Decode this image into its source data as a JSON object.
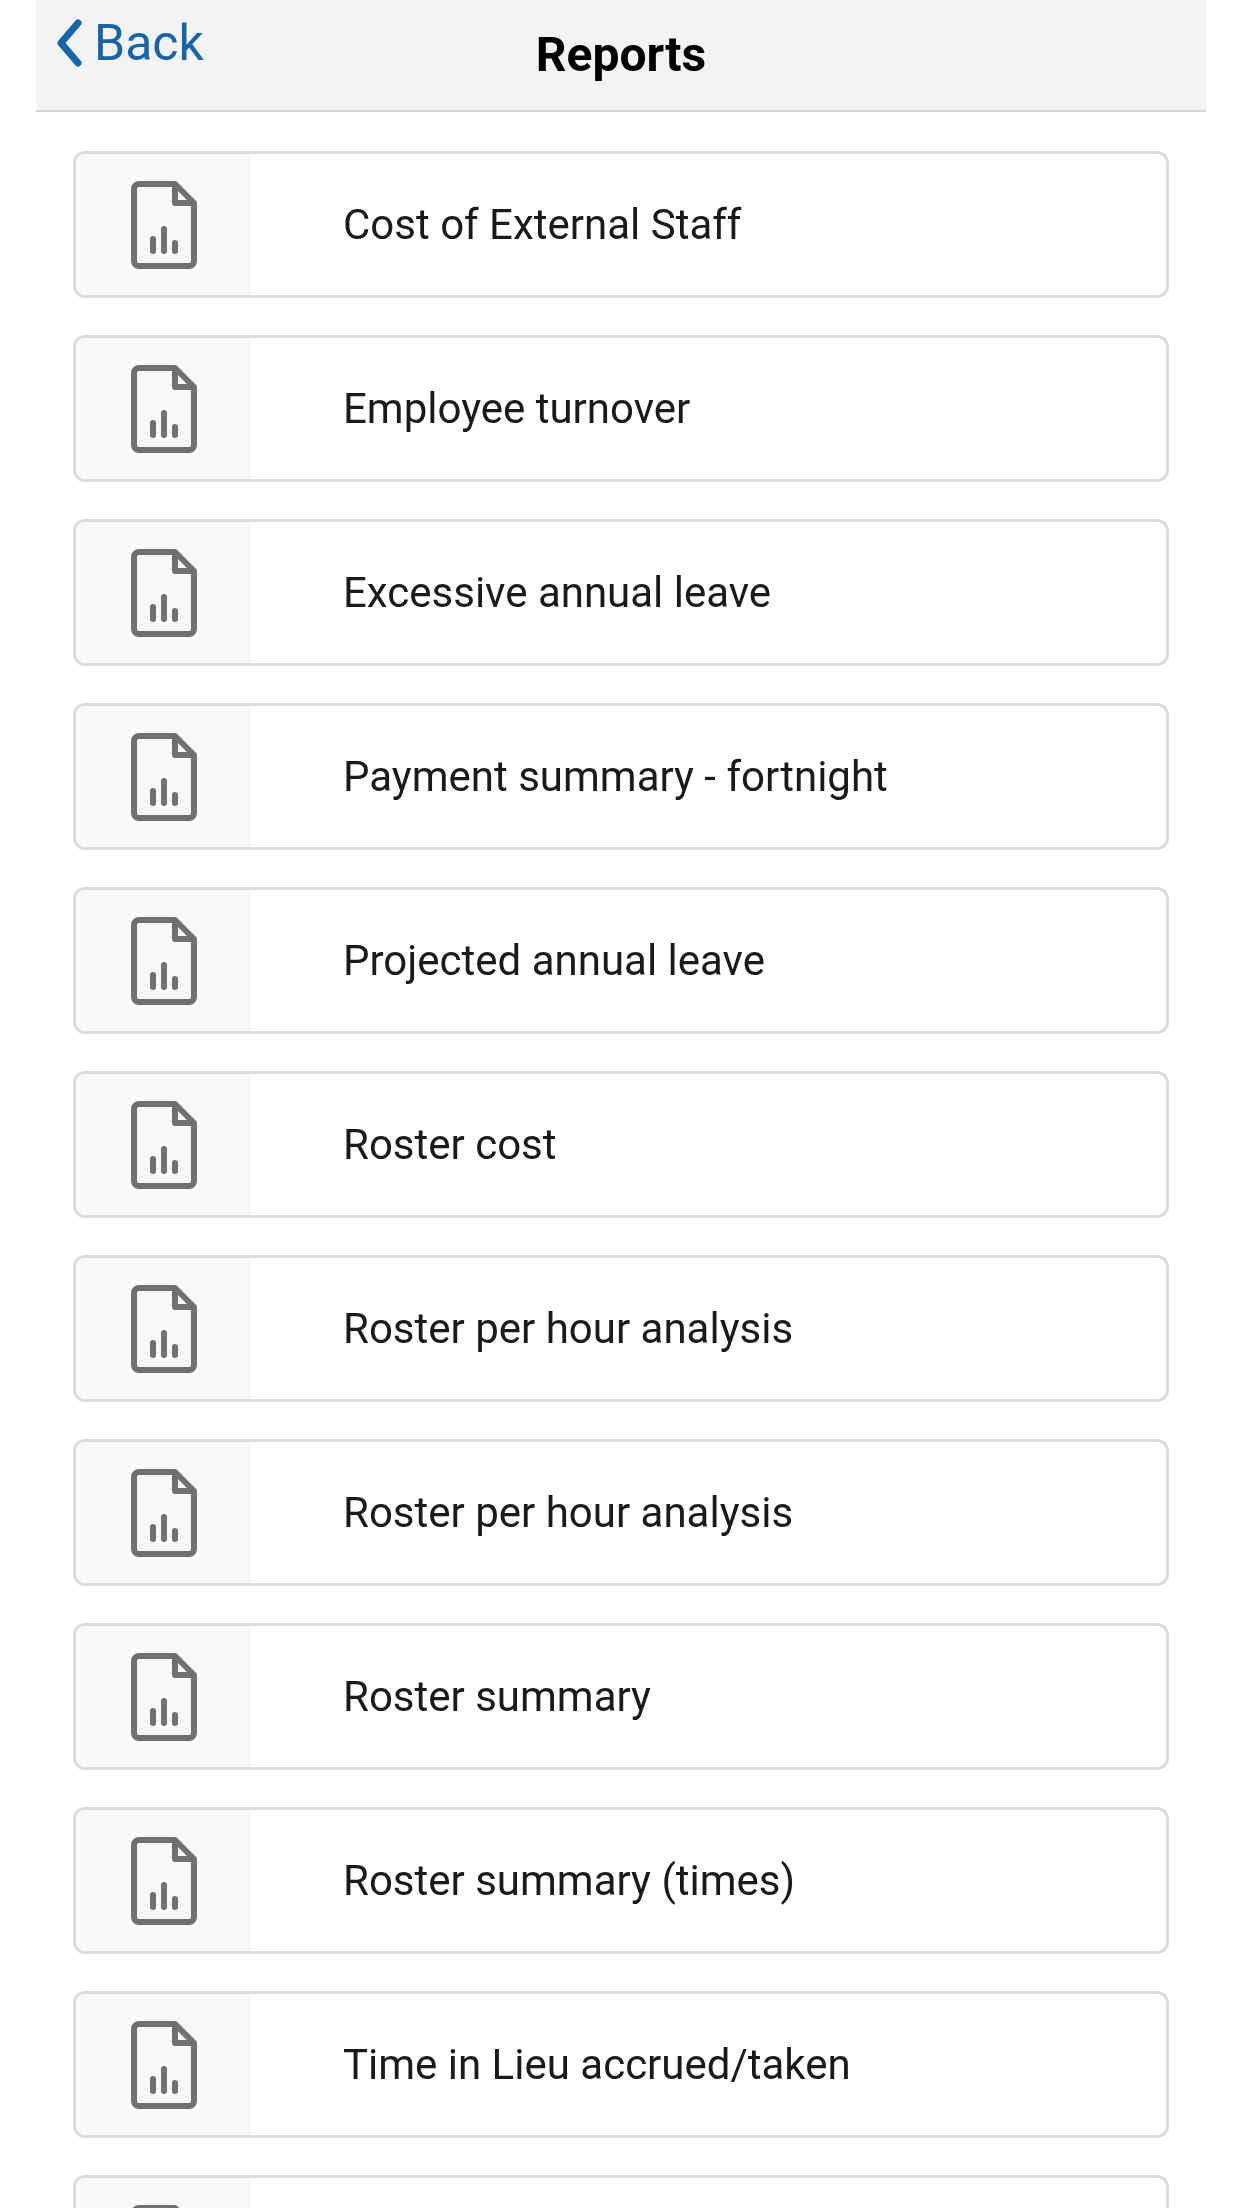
{
  "header": {
    "back": "Back",
    "title": "Reports"
  },
  "reports": [
    {
      "kind": "report",
      "label": "Cost of External Staff"
    },
    {
      "kind": "report",
      "label": "Employee turnover"
    },
    {
      "kind": "report",
      "label": "Excessive annual leave"
    },
    {
      "kind": "report",
      "label": "Payment summary - fortnight"
    },
    {
      "kind": "report",
      "label": "Projected annual leave"
    },
    {
      "kind": "report",
      "label": "Roster cost"
    },
    {
      "kind": "report",
      "label": "Roster per hour analysis"
    },
    {
      "kind": "report",
      "label": "Roster per hour analysis"
    },
    {
      "kind": "report",
      "label": "Roster summary"
    },
    {
      "kind": "report",
      "label": "Roster summary (times)"
    },
    {
      "kind": "report",
      "label": "Time in Lieu accrued/taken"
    },
    {
      "kind": "partial"
    }
  ]
}
